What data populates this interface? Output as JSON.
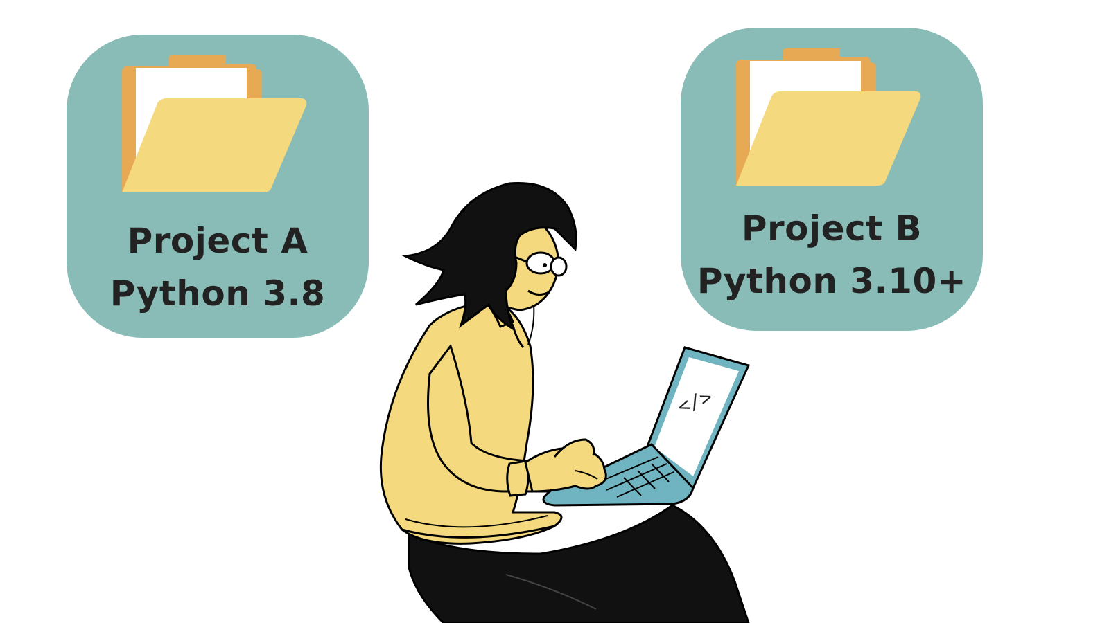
{
  "projects": [
    {
      "name": "Project A",
      "python_version": "Python 3.8",
      "icon": "folder-icon"
    },
    {
      "name": "Project B",
      "python_version": "Python 3.10+",
      "icon": "folder-icon"
    }
  ],
  "illustration": {
    "icon": "person-with-laptop",
    "screen_glyph": "</>"
  },
  "colors": {
    "card": "#89bcb6",
    "folder_front": "#f4d97e",
    "folder_back": "#e8a955",
    "sweater": "#f4d97e",
    "laptop": "#6fb4c0",
    "text": "#222222"
  }
}
